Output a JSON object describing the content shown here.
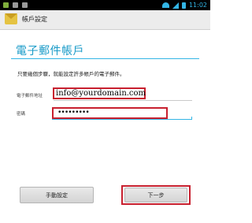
{
  "status_bar": {
    "time": "11:02"
  },
  "action_bar": {
    "title": "帳戶設定"
  },
  "main": {
    "title": "電子郵件帳戶",
    "instruction": "只要幾個步驟，就能設定許多帳戶的電子郵件。",
    "email": {
      "label": "電子郵件地址",
      "value": "info@yourdomain.com"
    },
    "password": {
      "label": "密碼",
      "value": "•••••••••"
    }
  },
  "buttons": {
    "manual_setup": "手動設定",
    "next": "下一步"
  },
  "colors": {
    "accent": "#33b5e5",
    "highlight": "#c8202f"
  }
}
